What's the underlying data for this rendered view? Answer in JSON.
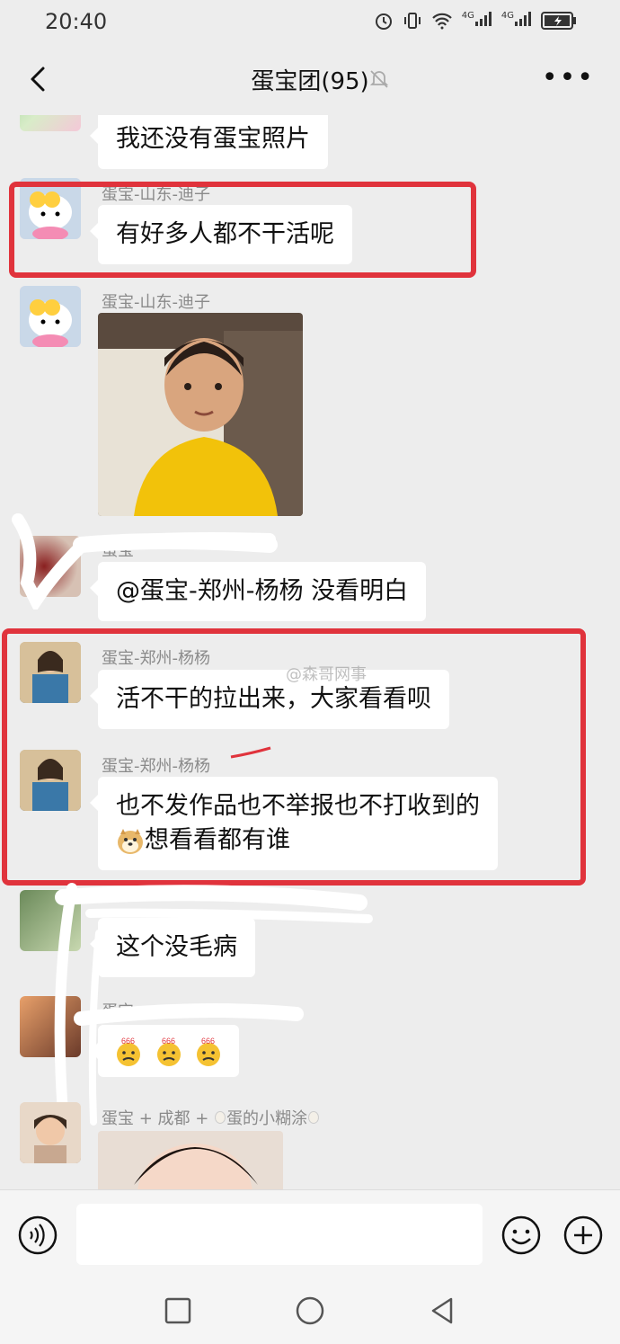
{
  "status_bar": {
    "time": "20:40",
    "icons": [
      "alarm-icon",
      "vibrate-icon",
      "wifi-icon",
      "4g-signal-icon",
      "4g-signal-icon",
      "battery-charging-icon"
    ],
    "network_label_1": "4G",
    "network_label_2": "4G"
  },
  "header": {
    "title": "蛋宝团(95)",
    "icons": [
      "back-icon",
      "mute-icon",
      "more-icon"
    ]
  },
  "messages": [
    {
      "text": "我还没有蛋宝照片"
    },
    {
      "sender": "蛋宝-山东-迪子",
      "text": "有好多人都不干活呢",
      "highlighted": true
    },
    {
      "sender": "蛋宝-山东-迪子",
      "type": "image"
    },
    {
      "sender": "蛋宝",
      "text": "@蛋宝-郑州-杨杨  没看明白",
      "scribbled": true
    },
    {
      "sender": "蛋宝-郑州-杨杨",
      "text": "活不干的拉出来，大家看看呗",
      "highlighted": true
    },
    {
      "sender": "蛋宝-郑州-杨杨",
      "text_line1": "也不发作品也不举报也不打收到的",
      "text_line2": "想看看都有谁",
      "emoji": "doge-emoji",
      "highlighted": true
    },
    {
      "text": "这个没毛病",
      "scribbled": true
    },
    {
      "sender": "蛋宝",
      "emoji": "666-emoji",
      "emoji_count": 3,
      "scribbled": true
    },
    {
      "sender": "蛋宝 + 成都 + ",
      "sender_suffix": "蛋的小糊涂",
      "type": "image"
    }
  ],
  "watermark": "@森哥网事",
  "input_bar": {
    "placeholder": "",
    "icons": [
      "voice-icon",
      "emoji-icon",
      "plus-icon"
    ]
  },
  "system_nav": {
    "icons": [
      "recent-apps-icon",
      "home-icon",
      "back-triangle-icon"
    ]
  },
  "colors": {
    "background": "#ededed",
    "bubble": "#ffffff",
    "highlight": "#e0333c",
    "sender_text": "#8a8a8a"
  }
}
